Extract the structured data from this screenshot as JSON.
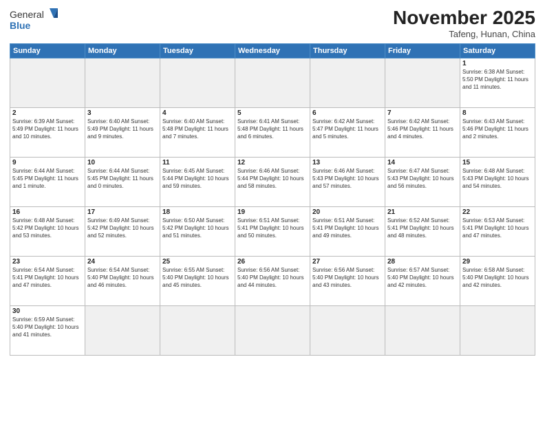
{
  "header": {
    "logo_general": "General",
    "logo_blue": "Blue",
    "month_title": "November 2025",
    "location": "Tafeng, Hunan, China"
  },
  "weekdays": [
    "Sunday",
    "Monday",
    "Tuesday",
    "Wednesday",
    "Thursday",
    "Friday",
    "Saturday"
  ],
  "weeks": [
    [
      {
        "day": "",
        "info": "",
        "empty": true
      },
      {
        "day": "",
        "info": "",
        "empty": true
      },
      {
        "day": "",
        "info": "",
        "empty": true
      },
      {
        "day": "",
        "info": "",
        "empty": true
      },
      {
        "day": "",
        "info": "",
        "empty": true
      },
      {
        "day": "",
        "info": "",
        "empty": true
      },
      {
        "day": "1",
        "info": "Sunrise: 6:38 AM\nSunset: 5:50 PM\nDaylight: 11 hours and 11 minutes.",
        "empty": false
      }
    ],
    [
      {
        "day": "2",
        "info": "Sunrise: 6:39 AM\nSunset: 5:49 PM\nDaylight: 11 hours and 10 minutes.",
        "empty": false
      },
      {
        "day": "3",
        "info": "Sunrise: 6:40 AM\nSunset: 5:49 PM\nDaylight: 11 hours and 9 minutes.",
        "empty": false
      },
      {
        "day": "4",
        "info": "Sunrise: 6:40 AM\nSunset: 5:48 PM\nDaylight: 11 hours and 7 minutes.",
        "empty": false
      },
      {
        "day": "5",
        "info": "Sunrise: 6:41 AM\nSunset: 5:48 PM\nDaylight: 11 hours and 6 minutes.",
        "empty": false
      },
      {
        "day": "6",
        "info": "Sunrise: 6:42 AM\nSunset: 5:47 PM\nDaylight: 11 hours and 5 minutes.",
        "empty": false
      },
      {
        "day": "7",
        "info": "Sunrise: 6:42 AM\nSunset: 5:46 PM\nDaylight: 11 hours and 4 minutes.",
        "empty": false
      },
      {
        "day": "8",
        "info": "Sunrise: 6:43 AM\nSunset: 5:46 PM\nDaylight: 11 hours and 2 minutes.",
        "empty": false
      }
    ],
    [
      {
        "day": "9",
        "info": "Sunrise: 6:44 AM\nSunset: 5:45 PM\nDaylight: 11 hours and 1 minute.",
        "empty": false
      },
      {
        "day": "10",
        "info": "Sunrise: 6:44 AM\nSunset: 5:45 PM\nDaylight: 11 hours and 0 minutes.",
        "empty": false
      },
      {
        "day": "11",
        "info": "Sunrise: 6:45 AM\nSunset: 5:44 PM\nDaylight: 10 hours and 59 minutes.",
        "empty": false
      },
      {
        "day": "12",
        "info": "Sunrise: 6:46 AM\nSunset: 5:44 PM\nDaylight: 10 hours and 58 minutes.",
        "empty": false
      },
      {
        "day": "13",
        "info": "Sunrise: 6:46 AM\nSunset: 5:43 PM\nDaylight: 10 hours and 57 minutes.",
        "empty": false
      },
      {
        "day": "14",
        "info": "Sunrise: 6:47 AM\nSunset: 5:43 PM\nDaylight: 10 hours and 56 minutes.",
        "empty": false
      },
      {
        "day": "15",
        "info": "Sunrise: 6:48 AM\nSunset: 5:43 PM\nDaylight: 10 hours and 54 minutes.",
        "empty": false
      }
    ],
    [
      {
        "day": "16",
        "info": "Sunrise: 6:48 AM\nSunset: 5:42 PM\nDaylight: 10 hours and 53 minutes.",
        "empty": false
      },
      {
        "day": "17",
        "info": "Sunrise: 6:49 AM\nSunset: 5:42 PM\nDaylight: 10 hours and 52 minutes.",
        "empty": false
      },
      {
        "day": "18",
        "info": "Sunrise: 6:50 AM\nSunset: 5:42 PM\nDaylight: 10 hours and 51 minutes.",
        "empty": false
      },
      {
        "day": "19",
        "info": "Sunrise: 6:51 AM\nSunset: 5:41 PM\nDaylight: 10 hours and 50 minutes.",
        "empty": false
      },
      {
        "day": "20",
        "info": "Sunrise: 6:51 AM\nSunset: 5:41 PM\nDaylight: 10 hours and 49 minutes.",
        "empty": false
      },
      {
        "day": "21",
        "info": "Sunrise: 6:52 AM\nSunset: 5:41 PM\nDaylight: 10 hours and 48 minutes.",
        "empty": false
      },
      {
        "day": "22",
        "info": "Sunrise: 6:53 AM\nSunset: 5:41 PM\nDaylight: 10 hours and 47 minutes.",
        "empty": false
      }
    ],
    [
      {
        "day": "23",
        "info": "Sunrise: 6:54 AM\nSunset: 5:41 PM\nDaylight: 10 hours and 47 minutes.",
        "empty": false
      },
      {
        "day": "24",
        "info": "Sunrise: 6:54 AM\nSunset: 5:40 PM\nDaylight: 10 hours and 46 minutes.",
        "empty": false
      },
      {
        "day": "25",
        "info": "Sunrise: 6:55 AM\nSunset: 5:40 PM\nDaylight: 10 hours and 45 minutes.",
        "empty": false
      },
      {
        "day": "26",
        "info": "Sunrise: 6:56 AM\nSunset: 5:40 PM\nDaylight: 10 hours and 44 minutes.",
        "empty": false
      },
      {
        "day": "27",
        "info": "Sunrise: 6:56 AM\nSunset: 5:40 PM\nDaylight: 10 hours and 43 minutes.",
        "empty": false
      },
      {
        "day": "28",
        "info": "Sunrise: 6:57 AM\nSunset: 5:40 PM\nDaylight: 10 hours and 42 minutes.",
        "empty": false
      },
      {
        "day": "29",
        "info": "Sunrise: 6:58 AM\nSunset: 5:40 PM\nDaylight: 10 hours and 42 minutes.",
        "empty": false
      }
    ],
    [
      {
        "day": "30",
        "info": "Sunrise: 6:59 AM\nSunset: 5:40 PM\nDaylight: 10 hours and 41 minutes.",
        "empty": false
      },
      {
        "day": "",
        "info": "",
        "empty": true
      },
      {
        "day": "",
        "info": "",
        "empty": true
      },
      {
        "day": "",
        "info": "",
        "empty": true
      },
      {
        "day": "",
        "info": "",
        "empty": true
      },
      {
        "day": "",
        "info": "",
        "empty": true
      },
      {
        "day": "",
        "info": "",
        "empty": true
      }
    ]
  ]
}
